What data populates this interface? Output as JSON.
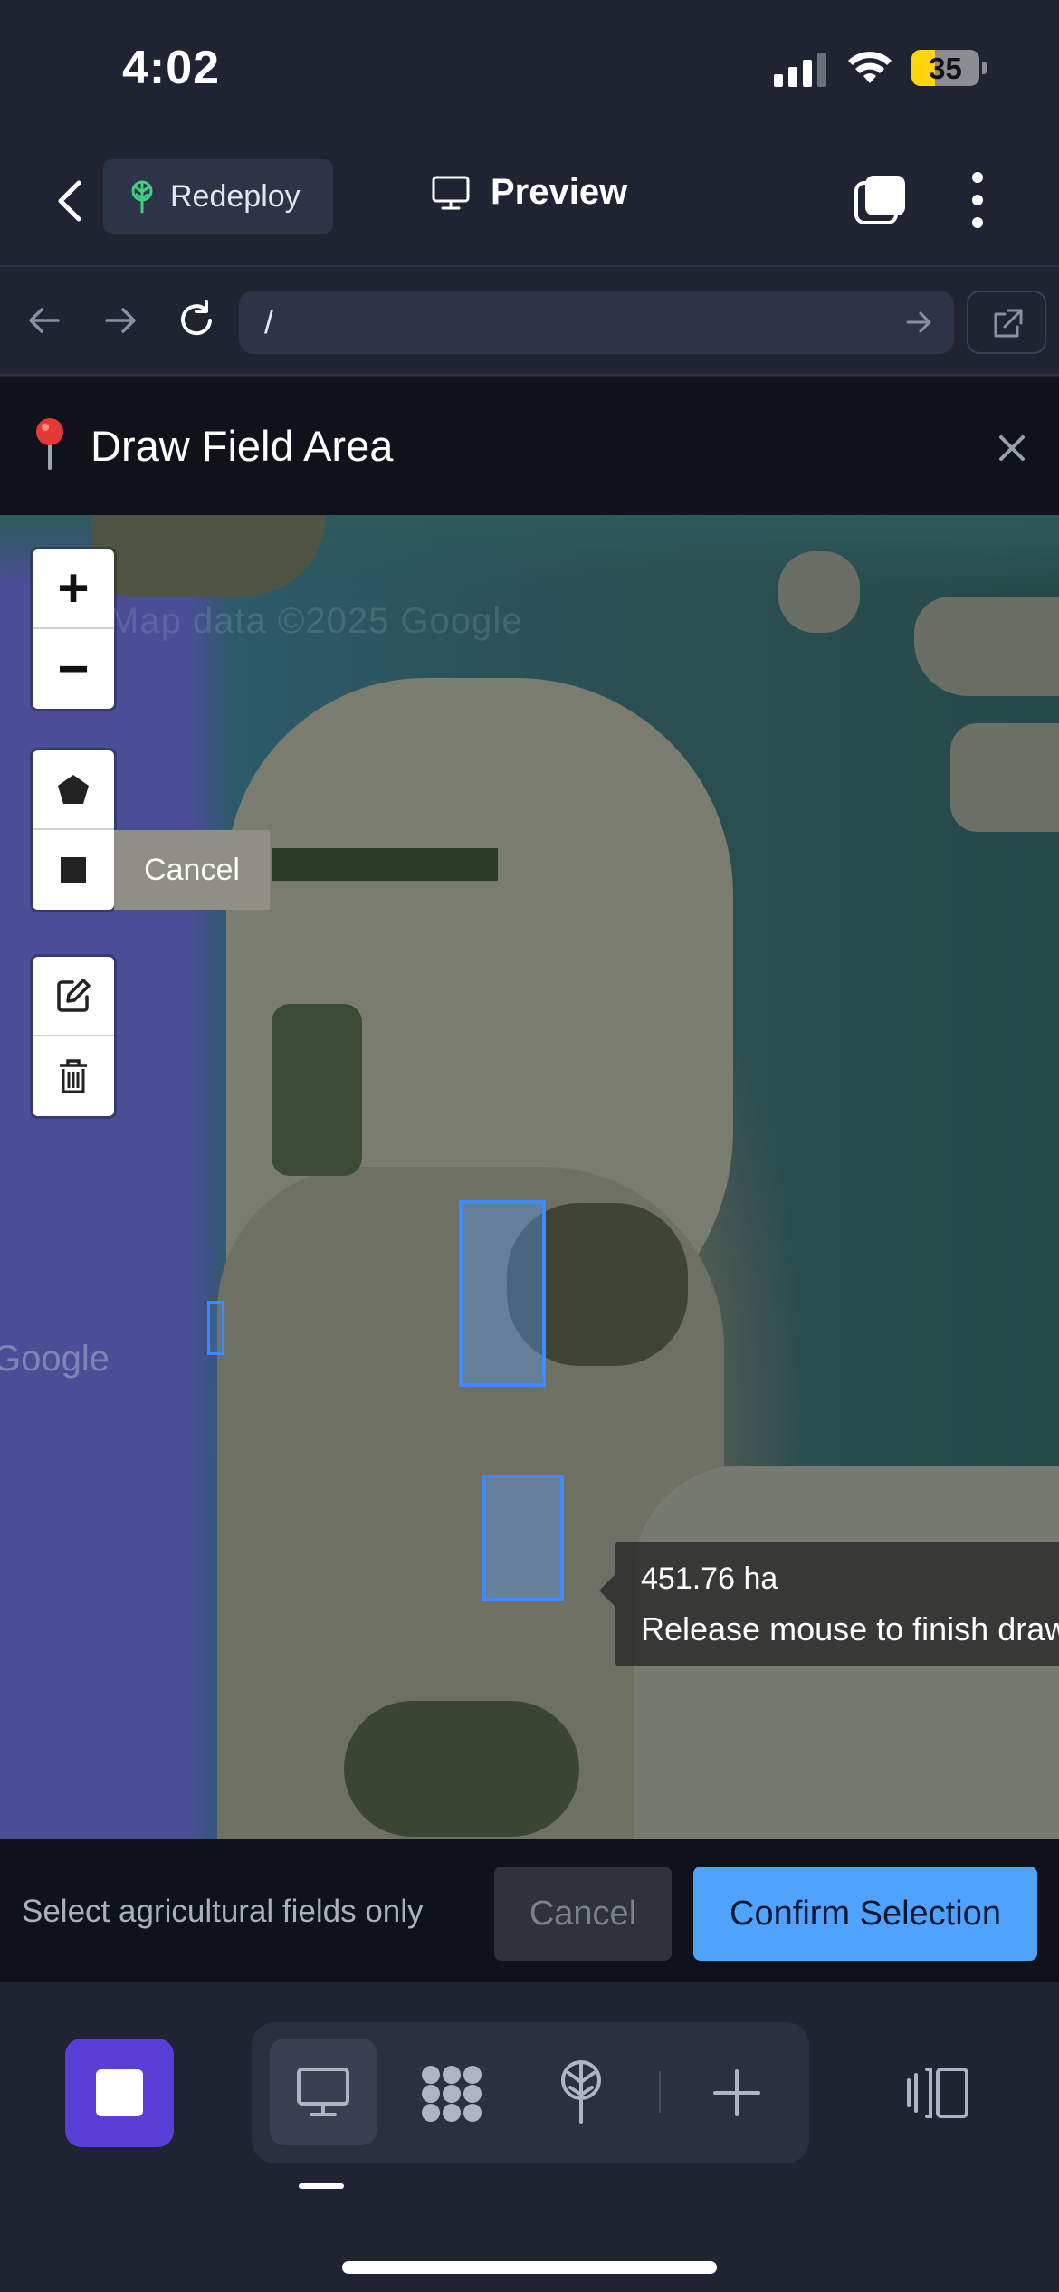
{
  "status_bar": {
    "time": "4:02",
    "battery": "35"
  },
  "app_bar": {
    "redeploy_label": "Redeploy",
    "preview_label": "Preview"
  },
  "browser": {
    "url": "/"
  },
  "modal": {
    "title": "Draw Field Area",
    "pin_icon": "round-pushpin-icon"
  },
  "map": {
    "watermark_top": "Map data ©2025 Google",
    "watermark_left": "Google",
    "draw_cancel_label": "Cancel",
    "tooltip": {
      "area": "451.76 ha",
      "instruction": "Release mouse to finish drawing."
    },
    "rect_color": "#3d8bff"
  },
  "action_bar": {
    "hint": "Select agricultural fields only",
    "cancel_label": "Cancel",
    "confirm_label": "Confirm Selection",
    "confirm_color": "#4fa3ff"
  },
  "colors": {
    "background": "#1f2332",
    "modal_header": "#0f121a",
    "stop_button": "#5a3fd6"
  }
}
